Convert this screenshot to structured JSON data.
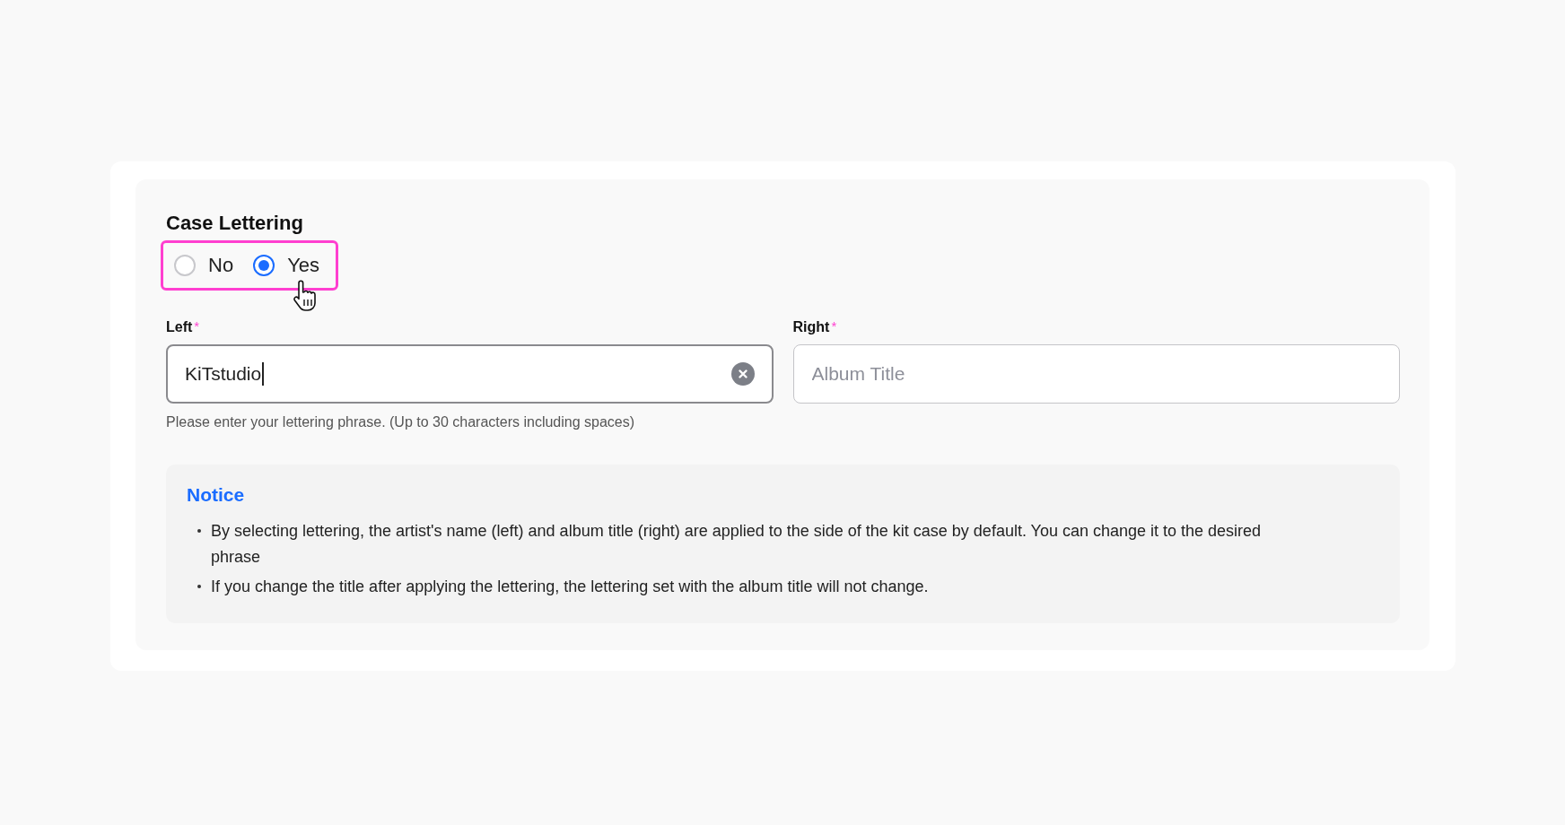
{
  "section": {
    "title": "Case Lettering"
  },
  "radio_group": {
    "highlighted": true,
    "options": [
      {
        "label": "No",
        "selected": false
      },
      {
        "label": "Yes",
        "selected": true
      }
    ]
  },
  "fields": [
    {
      "label": "Left",
      "required_mark": "*",
      "value": "KiTstudio",
      "focused": true,
      "clearable": true
    },
    {
      "label": "Right",
      "required_mark": "*",
      "placeholder": "Album Title",
      "focused": false,
      "clearable": false
    }
  ],
  "helper_text": "Please enter your lettering phrase. (Up to 30 characters including spaces)",
  "notice": {
    "title": "Notice",
    "items": [
      "By selecting lettering, the artist's name (left) and album title (right) are applied to the side of the kit case by default. You can change it to the desired phrase",
      "If you change the title after applying the lettering, the lettering set with the album title will not change."
    ]
  }
}
